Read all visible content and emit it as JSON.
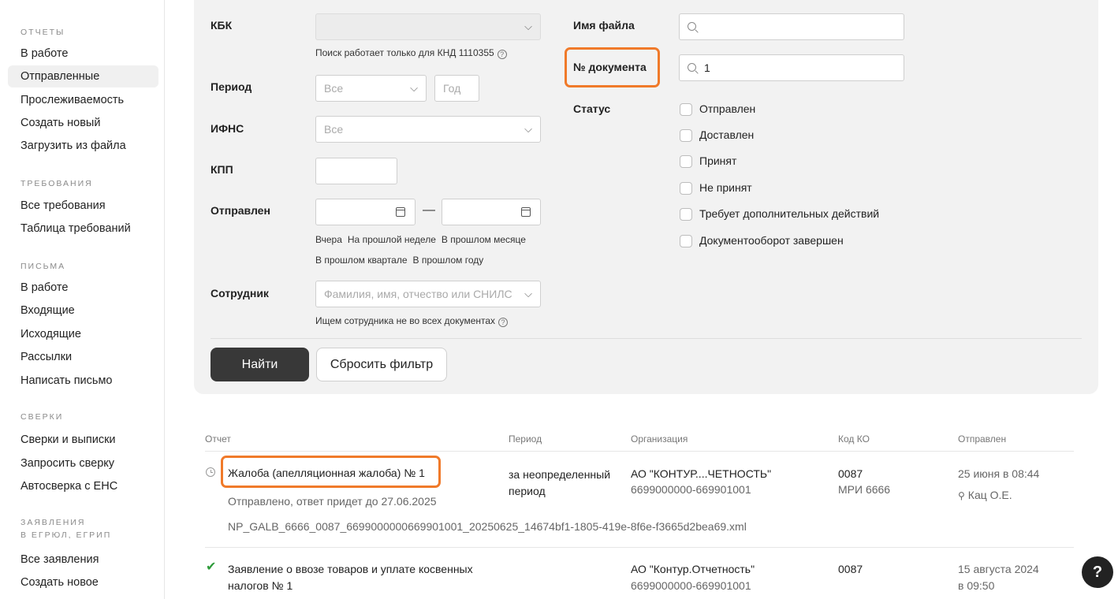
{
  "sidebar": {
    "sections": [
      {
        "title": "ОТЧЕТЫ",
        "items": [
          "В работе",
          "Отправленные",
          "Прослеживаемость",
          "Создать новый",
          "Загрузить из файла"
        ]
      },
      {
        "title": "ТРЕБОВАНИЯ",
        "items": [
          "Все требования",
          "Таблица требований"
        ]
      },
      {
        "title": "ПИСЬМА",
        "items": [
          "В работе",
          "Входящие",
          "Исходящие",
          "Рассылки",
          "Написать письмо"
        ]
      },
      {
        "title": "СВЕРКИ",
        "items": [
          "Сверки и выписки",
          "Запросить сверку",
          "Автосверка с ЕНС"
        ]
      },
      {
        "title": "ЗАЯВЛЕНИЯ",
        "subtitle": "В ЕГРЮЛ, ЕГРИП",
        "items": [
          "Все заявления",
          "Создать новое"
        ]
      }
    ],
    "active_item": "Отправленные"
  },
  "filter": {
    "kbk": {
      "label": "КБК",
      "value": "",
      "hint": "Поиск работает только для КНД 1110355"
    },
    "period": {
      "label": "Период",
      "value": "Все",
      "year_placeholder": "Год"
    },
    "ifns": {
      "label": "ИФНС",
      "value": "Все"
    },
    "kpp": {
      "label": "КПП",
      "value": ""
    },
    "sent": {
      "label": "Отправлен",
      "dash": "—",
      "quick_links": [
        "Вчера",
        "На прошлой неделе",
        "В прошлом месяце",
        "В прошлом квартале",
        "В прошлом году"
      ]
    },
    "employee": {
      "label": "Сотрудник",
      "placeholder": "Фамилия, имя, отчество или СНИЛС",
      "hint": "Ищем сотрудника не во всех документах"
    },
    "file_name": {
      "label": "Имя файла",
      "value": ""
    },
    "doc_number": {
      "label": "№ документа",
      "value": "1"
    },
    "status": {
      "label": "Статус",
      "options": [
        "Отправлен",
        "Доставлен",
        "Принят",
        "Не принят",
        "Требует дополнительных действий",
        "Документооборот завершен"
      ]
    },
    "find_button": "Найти",
    "reset_button": "Сбросить фильтр"
  },
  "table": {
    "columns": [
      "Отчет",
      "Период",
      "Организация",
      "Код КО",
      "Отправлен"
    ],
    "rows": [
      {
        "title": "Жалоба (апелляционная жалоба) № 1",
        "status_text": "Отправлено, ответ придет до 27.06.2025",
        "file": "NP_GALB_6666_0087_6699000000669901001_20250625_14674bf1-1805-419e-8f6e-f3665d2bea69.xml",
        "period": "за неопределенный период",
        "org": "АО \"КОНТУР....ЧЕТНОСТЬ\"",
        "org_ids": "6699000000-669901001",
        "code": "0087",
        "code_name": "МРИ 6666",
        "sent": "25 июня в 08:44",
        "author": "Кац О.Е.",
        "icon": "clock-icon"
      },
      {
        "title_line1": "Заявление о ввозе товаров и уплате косвенных",
        "title_line2": "налогов № 1",
        "org": "АО \"Контур.Отчетность\"",
        "org_ids": "6699000000-669901001",
        "code": "0087",
        "sent_line1": "15 августа 2024",
        "sent_line2": "в 09:50",
        "icon": "check-icon"
      }
    ]
  },
  "help_label": "?",
  "colors": {
    "highlight": "#f07a2a",
    "primary_button": "#383838",
    "success": "#2e9b3a",
    "panel_bg": "#f2f2f2"
  }
}
